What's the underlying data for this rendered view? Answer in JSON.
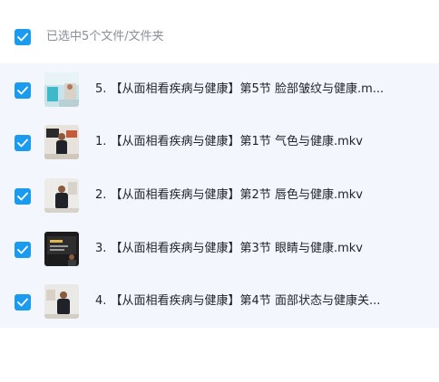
{
  "header": {
    "selection_text": "已选中5个文件/文件夹"
  },
  "files": [
    {
      "name": "5. 【从面相看疾病与健康】第5节 脸部皱纹与健康.m...",
      "thumb_icon": "video-thumbnail-clinic"
    },
    {
      "name": "1. 【从面相看疾病与健康】第1节 气色与健康.mkv",
      "thumb_icon": "video-thumbnail-lecturer"
    },
    {
      "name": "2. 【从面相看疾病与健康】第2节 唇色与健康.mkv",
      "thumb_icon": "video-thumbnail-lecturer"
    },
    {
      "name": "3. 【从面相看疾病与健康】第3节 眼睛与健康.mkv",
      "thumb_icon": "video-thumbnail-screen"
    },
    {
      "name": "4. 【从面相看疾病与健康】第4节 面部状态与健康关...",
      "thumb_icon": "video-thumbnail-lecturer"
    }
  ],
  "colors": {
    "checkbox": "#1a9bf0",
    "list_background": "#f3f7fd"
  }
}
